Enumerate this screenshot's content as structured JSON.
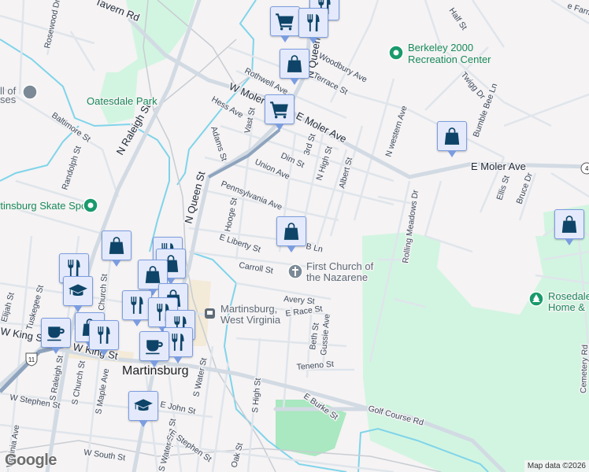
{
  "map": {
    "city_label": "Martinsburg",
    "attribution": "Map data ©2026",
    "logo": "Google",
    "colors": {
      "background": "#f5f3f4",
      "park": "#d2f5e1",
      "golf": "#a9e8c0",
      "water": "#7fd4ea",
      "road": "#d5dde6",
      "highlight": "#8ea3bd",
      "marker_fill": "#e4eafb",
      "marker_icon": "#0e4468"
    },
    "streets": {
      "tavern": "Tavern Rd",
      "rosewood": "Rosewood Dr",
      "rothwell": "Rothwell Ave",
      "wmoler": "W Moler Ave",
      "hess": "Hess Ave",
      "vast": "Vast St",
      "baltimore": "Baltimore St",
      "nraleigh": "N Raleigh St",
      "adams": "Adams St",
      "randolph": "Randolph St",
      "union": "Union Ave",
      "dim": "Dim St",
      "pennsylvania": "Pennsylvania Ave",
      "nqueen": "N Queen St",
      "hooge": "Hooge St",
      "woodbury": "Woodbury Ave",
      "terrace": "Terrace St",
      "emoler": "E Moler Ave",
      "emoler2": "E Moler Ave",
      "nwestern": "N western Ave",
      "third": "3rd St",
      "nhigh": "N High St",
      "albert": "Albert St",
      "half": "Half St",
      "twigg": "Twigg Dr",
      "bumblebee": "Bumble Bee Ln",
      "ellis": "Ellis St",
      "bruce": "Bruce Dr",
      "rolling": "Rolling Meadows Dr",
      "eliberty": "E Liberty St",
      "carroll": "Carroll St",
      "bln": "B Ln",
      "avery": "Avery St",
      "erace": "E Race St",
      "beth": "Beth St",
      "gussie": "Gussie Ave",
      "teneno": "Teneno St",
      "eburke": "E Burke St",
      "golfcourse": "Golf Course Rd",
      "cemetery": "Cemetery Rd",
      "elijah": "Elijah St",
      "tuskegee": "Tuskegee St",
      "church": "Church St",
      "wking": "W King St",
      "wking2": "W King St",
      "sraleigh": "S Raleigh St",
      "schurch": "S Church St",
      "smaple": "S Maple Ave",
      "wstephen": "W Stephen St",
      "ejohn": "E John St",
      "sspring": "S Spring St",
      "swater": "S Water St",
      "swater2": "S Water St",
      "estephen": "E Stephen St",
      "wsouth": "W South St",
      "oak": "Oak St",
      "shigh": "S High St",
      "virginia": "Virginia Ave",
      "route11": "11"
    },
    "places": {
      "oatesdale": "Oatesdale Park",
      "skate": "Martinsburg Skate Spot",
      "berkeley_l1": "Berkeley 2000",
      "berkeley_l2": "Recreation Center",
      "church_l1": "First Church of",
      "church_l2": "the Nazarene",
      "station_l1": "Martinsburg,",
      "station_l2": "West Virginia",
      "rosedale_l1": "Rosedale",
      "rosedale_l2": "Home &",
      "hall_l1": "ll of",
      "hall_l2": "ses",
      "farm": "e Farm"
    },
    "markers": [
      {
        "type": "grocery"
      },
      {
        "type": "restaurant"
      },
      {
        "type": "restaurant"
      },
      {
        "type": "shopping"
      },
      {
        "type": "grocery"
      },
      {
        "type": "shopping"
      },
      {
        "type": "shopping"
      },
      {
        "type": "shopping"
      },
      {
        "type": "shopping"
      },
      {
        "type": "restaurant"
      },
      {
        "type": "school"
      },
      {
        "type": "cafe"
      },
      {
        "type": "shopping"
      },
      {
        "type": "restaurant"
      },
      {
        "type": "restaurant"
      },
      {
        "type": "shopping"
      },
      {
        "type": "shopping"
      },
      {
        "type": "restaurant"
      },
      {
        "type": "restaurant"
      },
      {
        "type": "restaurant"
      },
      {
        "type": "cafe"
      },
      {
        "type": "restaurant"
      },
      {
        "type": "school"
      }
    ]
  }
}
